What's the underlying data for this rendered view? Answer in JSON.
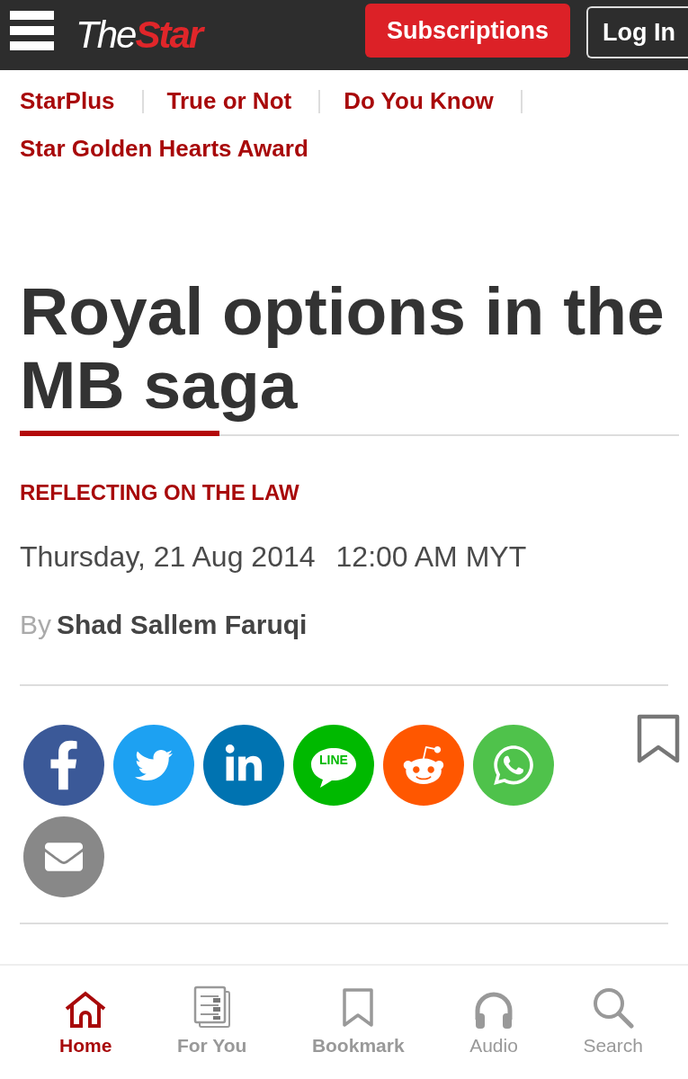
{
  "header": {
    "logo": {
      "part_1": "The",
      "part_2": "Star"
    },
    "buttons": [
      {
        "label": "Subscriptions",
        "kind": "filled"
      },
      {
        "label": "Log In",
        "kind": "outlined"
      }
    ]
  },
  "nav_links": [
    {
      "label": "StarPlus"
    },
    {
      "label": "True or Not"
    },
    {
      "label": "Do You Know"
    },
    {
      "label": "Star Golden Hearts Award"
    }
  ],
  "article": {
    "title": "Royal options in the MB saga",
    "category": "REFLECTING ON THE LAW",
    "date": "Thursday, 21 Aug 2014",
    "time": "12:00 AM MYT",
    "byline_prefix": "By",
    "author": "Shad Sallem Faruqi"
  },
  "share_buttons": [
    {
      "kind": "facebook",
      "color": "#3b5998"
    },
    {
      "kind": "twitter",
      "color": "#1da1f2"
    },
    {
      "kind": "linkedin",
      "color": "#0073b1"
    },
    {
      "kind": "line",
      "color": "#00b900",
      "label": "LINE"
    },
    {
      "kind": "reddit",
      "color": "#ff5700"
    },
    {
      "kind": "whatsapp",
      "color": "#4fc24b"
    },
    {
      "kind": "email",
      "color": "#888888"
    }
  ],
  "bottom_nav": [
    {
      "label": "Home",
      "kind": "home",
      "selected": true,
      "bold": true
    },
    {
      "label": "For You",
      "kind": "for_you",
      "selected": false,
      "bold": true
    },
    {
      "label": "Bookmark",
      "kind": "bookmark",
      "selected": false,
      "bold": true
    },
    {
      "label": "Audio",
      "kind": "audio",
      "selected": false,
      "bold": false
    },
    {
      "label": "Search",
      "kind": "search",
      "selected": false,
      "bold": false
    }
  ]
}
